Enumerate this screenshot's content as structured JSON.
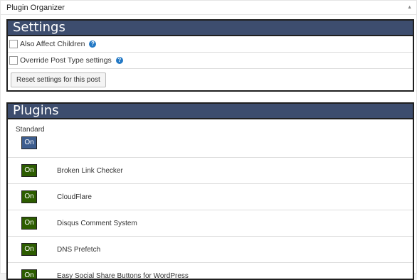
{
  "metabox": {
    "title": "Plugin Organizer"
  },
  "settings": {
    "heading": "Settings",
    "options": [
      {
        "label": "Also Affect Children",
        "checked": false,
        "help": "?"
      },
      {
        "label": "Override Post Type settings",
        "checked": false,
        "help": "?"
      }
    ],
    "reset_label": "Reset settings for this post"
  },
  "plugins": {
    "heading": "Plugins",
    "standard_label": "Standard",
    "standard_state": "On",
    "items": [
      {
        "name": "Broken Link Checker",
        "state": "On"
      },
      {
        "name": "CloudFlare",
        "state": "On"
      },
      {
        "name": "Disqus Comment System",
        "state": "On"
      },
      {
        "name": "DNS Prefetch",
        "state": "On"
      },
      {
        "name": "Easy Social Share Buttons for WordPress",
        "state": "On"
      }
    ]
  },
  "colors": {
    "panel_header": "#3d4d6e",
    "on_green": "#2c5c00",
    "on_blue": "#3d5d8e",
    "help_blue": "#2278c5"
  }
}
